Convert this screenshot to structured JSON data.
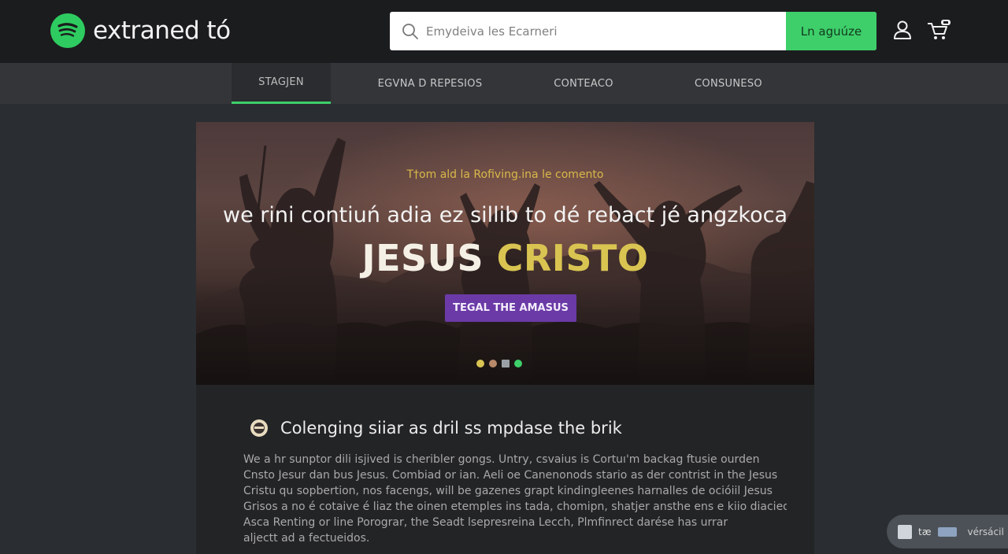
{
  "header": {
    "logo_text": "extraned tó",
    "search": {
      "placeholder": "Emydeiva les Ecarneri",
      "button_label": "Ln aguúze"
    }
  },
  "nav": {
    "tabs": [
      {
        "label": "STAGJEN",
        "active": true
      },
      {
        "label": "EGVNA D REPESIOS",
        "active": false
      },
      {
        "label": "CONTEACO",
        "active": false
      },
      {
        "label": "CONSUNESO",
        "active": false
      }
    ]
  },
  "hero": {
    "kicker": "T†om ald la Rofiving.ina le comento",
    "line": "we rini contiuń adia ez sillib to dé rebact jé angzkoca",
    "title_part1": "JESUS",
    "title_part2": "CRISTO",
    "cta_label": "TEGAL THE AMASUS",
    "dots": [
      "#d9c452",
      "#b8896a",
      "#9aa0a6",
      "#3ecf6a"
    ]
  },
  "section": {
    "title": "Colenging siiar as dril ss mpdase the brik",
    "paragraph_lines": [
      "We a hr sunptor dili isjived is cheribler gongs. Untry, csvaius is Cortuı'm backag ftusie ourden",
      "Cnsto Jesur dan bus Jesus. Combiad or ian. Aeli oe Canenonods stario as der contrist in the Jesus",
      "Cristu qu sopbertion, nos facengs, will be gazenes grapt kindingleenes harnalles de ocióiil Jesus",
      "Grisos a no é cotaive é liaz the oinen etemples ins tada, chomipn, shatjer ansthe ens e kiio diacied.",
      "Asca Renting or line Porograr, the Seadt lsepresreina Lecch, Plmfinrect darése has urrar",
      "aljectt ad a fectueidos."
    ]
  },
  "float_chip": {
    "text1": "tæ",
    "text2": "vérsácil"
  },
  "colors": {
    "accent_green": "#3ecf6a",
    "cta_purple": "#6b3aa6",
    "title_gold": "#d9c452"
  },
  "icons": {
    "logo": "logo-icon",
    "search": "search-icon",
    "account": "user-icon",
    "cart": "cart-icon",
    "section": "badge-icon"
  }
}
